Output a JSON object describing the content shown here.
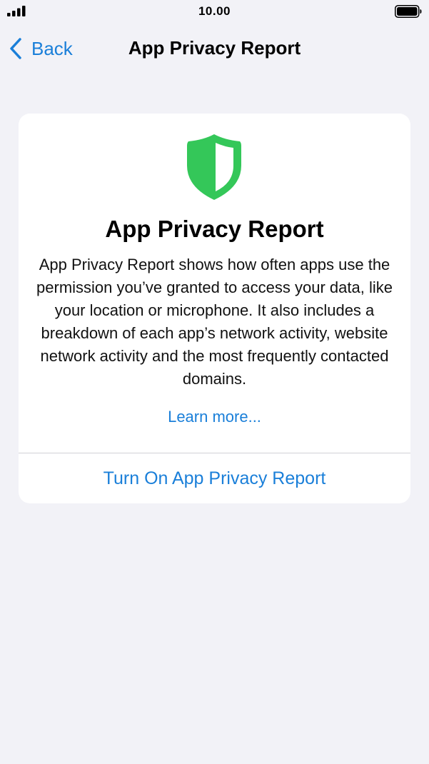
{
  "status_bar": {
    "time": "10.00",
    "signal_icon": "cellular-signal-icon",
    "battery_icon": "battery-full-icon"
  },
  "nav": {
    "back_label": "Back",
    "back_icon": "chevron-left-icon",
    "title": "App Privacy Report"
  },
  "card": {
    "icon": "shield-icon",
    "title": "App Privacy Report",
    "description": "App Privacy Report shows how often apps use the permission you’ve granted to access your data, like your location or microphone. It also includes a breakdown of each app’s network activity, website network activity and the most frequently contacted domains.",
    "learn_more": "Learn more...",
    "turn_on_label": "Turn On App Privacy Report"
  },
  "colors": {
    "accent": "#1a7fd9",
    "background": "#f2f2f7",
    "shield_green": "#34c759"
  }
}
